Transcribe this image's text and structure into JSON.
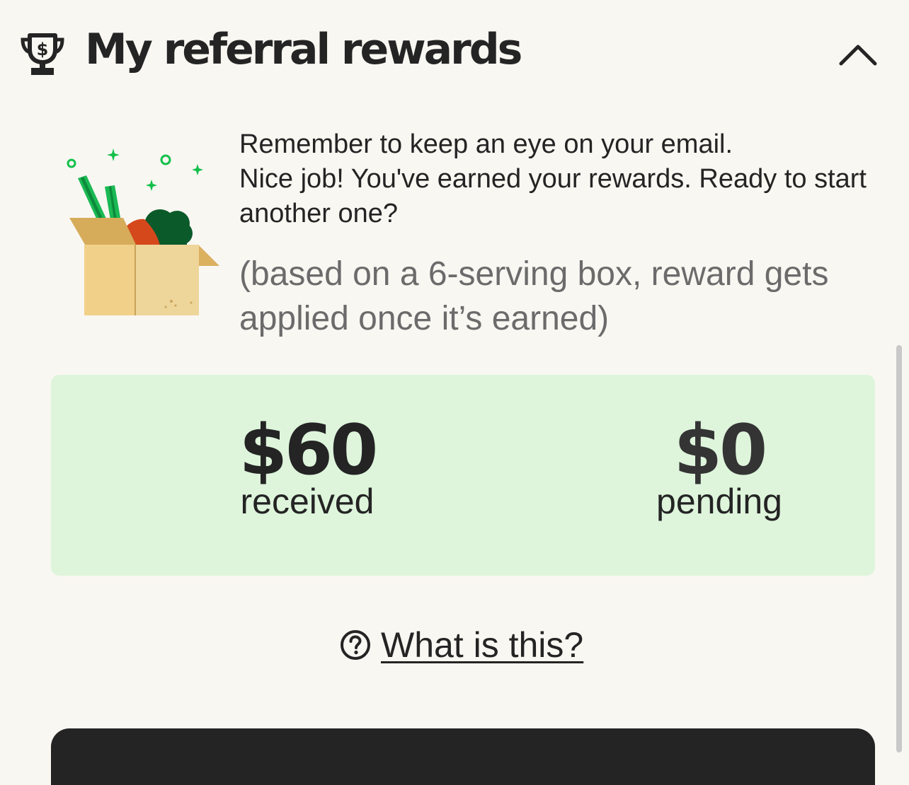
{
  "header": {
    "title": "My referral rewards",
    "icon": "trophy-dollar-icon",
    "toggle_icon": "chevron-up-icon"
  },
  "message": {
    "line1": "Remember to keep an eye on your email.",
    "line2": "Nice job! You've earned your rewards. Ready to start another one?"
  },
  "note": "(based on a 6-serving box, reward gets applied once it’s earned)",
  "rewards": {
    "received_amount": "$60",
    "received_label": "received",
    "pending_amount": "$0",
    "pending_label": "pending"
  },
  "help": {
    "icon": "question-circle-icon",
    "label": "What is this?"
  },
  "colors": {
    "background": "#f9f7f2",
    "card_green": "#def5dc",
    "text_dark": "#242424",
    "text_muted": "#6b6b6b",
    "accent_green": "#14c04b"
  }
}
